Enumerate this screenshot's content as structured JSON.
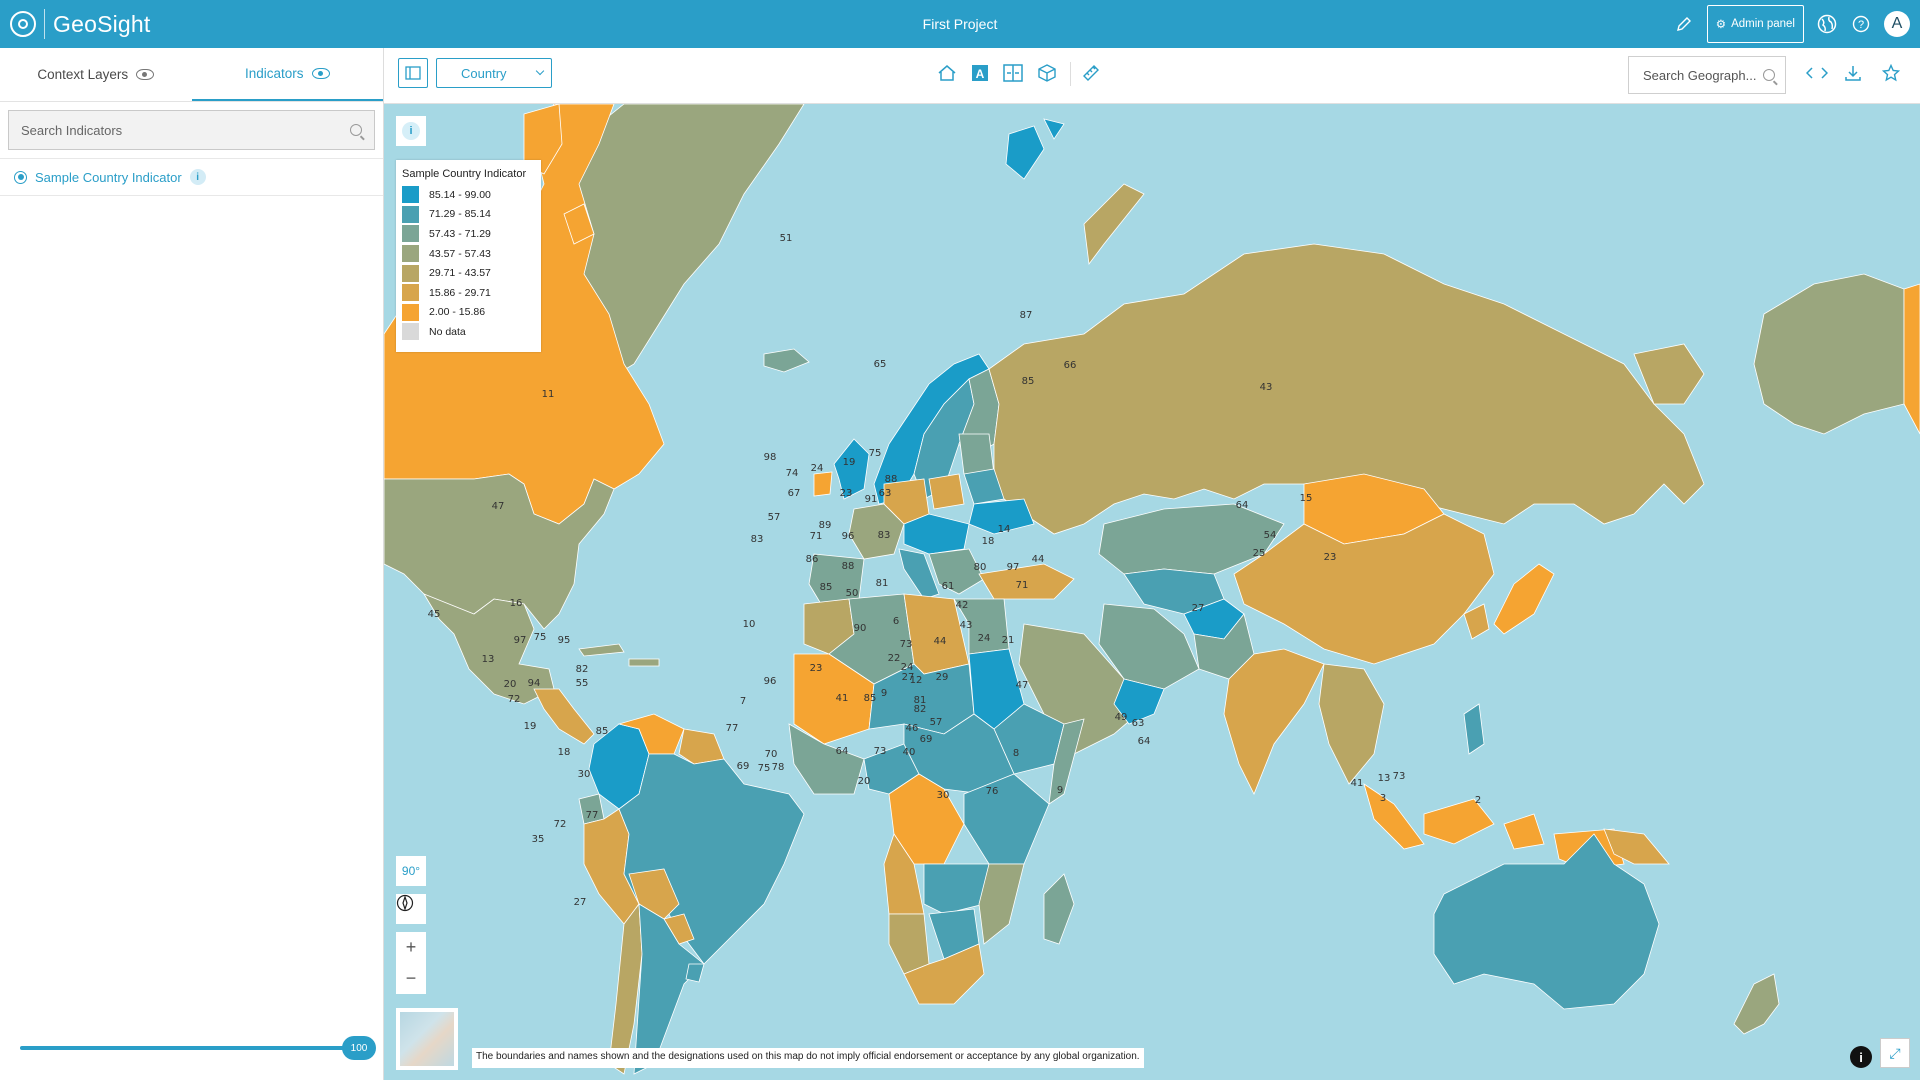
{
  "header": {
    "app_name": "GeoSight",
    "project_title": "First Project",
    "admin_label": "Admin panel",
    "avatar_letter": "A",
    "icons": [
      "pencil-icon",
      "gear-icon",
      "globe-icon",
      "help-icon"
    ]
  },
  "sidebar": {
    "tabs": [
      {
        "label": "Context Layers",
        "active": false
      },
      {
        "label": "Indicators",
        "active": true
      }
    ],
    "search_placeholder": "Search Indicators",
    "indicators": [
      {
        "label": "Sample Country Indicator",
        "selected": true
      }
    ],
    "transparency_value": "100"
  },
  "toolbar": {
    "level_select": "Country",
    "geo_search_placeholder": "Search Geograph...",
    "tools": [
      "home-icon",
      "label-icon",
      "compare-icon",
      "3d-icon",
      "measure-icon"
    ]
  },
  "legend": {
    "title": "Sample Country Indicator",
    "classes": [
      {
        "label": "85.14 - 99.00",
        "color": "#1a9cc8"
      },
      {
        "label": "71.29 - 85.14",
        "color": "#4aa0b2"
      },
      {
        "label": "57.43 - 71.29",
        "color": "#7ba596"
      },
      {
        "label": "43.57 - 57.43",
        "color": "#9aa67e"
      },
      {
        "label": "29.71 - 43.57",
        "color": "#b8a664"
      },
      {
        "label": "15.86 - 29.71",
        "color": "#d7a54c"
      },
      {
        "label": "2.00 - 15.86",
        "color": "#f5a432"
      },
      {
        "label": "No data",
        "color": "#d9d9d9"
      }
    ]
  },
  "map": {
    "pitch_label": "90°",
    "disclaimer": "The boundaries and names shown and the designations used on this map do not imply official endorsement or acceptance by any global organization.",
    "ocean_color": "#a6d8e4",
    "value_labels": [
      "51",
      "65",
      "87",
      "85",
      "66",
      "11",
      "47",
      "43",
      "15",
      "23",
      "64",
      "45",
      "16",
      "97",
      "75",
      "95",
      "13",
      "20",
      "94",
      "82",
      "55",
      "72",
      "19",
      "85",
      "18",
      "30",
      "72",
      "77",
      "35",
      "27",
      "67",
      "23",
      "63",
      "71",
      "96",
      "83",
      "86",
      "88",
      "85",
      "50",
      "81",
      "6",
      "90",
      "73",
      "22",
      "9",
      "27",
      "41",
      "85",
      "81",
      "46",
      "69",
      "20",
      "64",
      "73",
      "40",
      "30",
      "76",
      "8",
      "47",
      "24",
      "21",
      "44",
      "49",
      "63",
      "64",
      "73",
      "41",
      "13",
      "3",
      "2",
      "98",
      "74",
      "24",
      "19",
      "75",
      "88",
      "91",
      "57",
      "83",
      "89",
      "80",
      "97",
      "71",
      "14",
      "18",
      "42",
      "43",
      "61",
      "54",
      "25",
      "27",
      "9",
      "10",
      "7",
      "96",
      "77",
      "69",
      "75",
      "78",
      "70",
      "12",
      "29",
      "82",
      "57",
      "44",
      "24",
      "23"
    ]
  }
}
